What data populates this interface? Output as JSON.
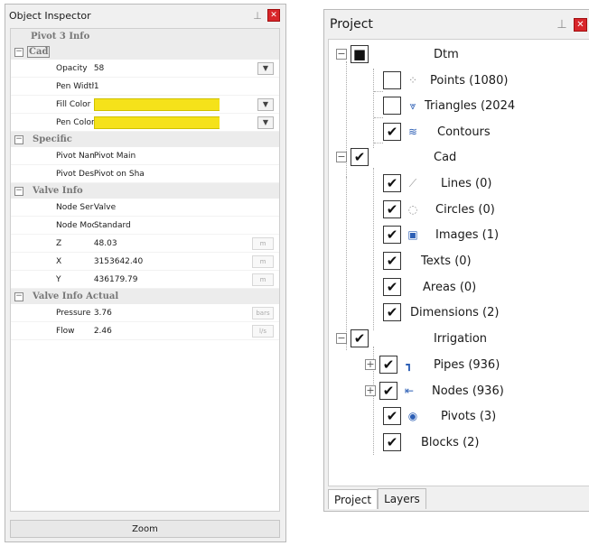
{
  "inspector": {
    "title": "Object Inspector",
    "header": "Pivot 3 Info",
    "categories": [
      {
        "name": "Cad",
        "rows": [
          {
            "key": "Opacity",
            "value": "58",
            "control": "dropdown"
          },
          {
            "key": "Pen Width",
            "value": "1"
          },
          {
            "key": "Fill Color",
            "value": "",
            "color": "#f5e21a",
            "control": "dropdown"
          },
          {
            "key": "Pen Color",
            "value": "",
            "color": "#f5e21a",
            "control": "dropdown"
          }
        ]
      },
      {
        "name": "Specific",
        "rows": [
          {
            "key": "Pivot Name",
            "value": "Pivot Main"
          },
          {
            "key": "Pivot Description",
            "value": "Pivot on Sha"
          }
        ]
      },
      {
        "name": "Valve Info",
        "rows": [
          {
            "key": "Node Series",
            "value": "Valve"
          },
          {
            "key": "Node Model",
            "value": "Standard"
          },
          {
            "key": "Z",
            "value": "48.03",
            "unit": "m"
          },
          {
            "key": "X",
            "value": "3153642.40",
            "unit": "m"
          },
          {
            "key": "Y",
            "value": "436179.79",
            "unit": "m"
          }
        ]
      },
      {
        "name": "Valve Info Actual",
        "rows": [
          {
            "key": "Pressure",
            "value": "3.76",
            "unit": "bars"
          },
          {
            "key": "Flow",
            "value": "2.46",
            "unit": "l/s"
          }
        ]
      }
    ],
    "zoom_label": "Zoom"
  },
  "project": {
    "title": "Project",
    "nodes": {
      "dtm": "Dtm",
      "points": "Points (1080)",
      "triangles": "Triangles (2024",
      "contours": "Contours",
      "cad": "Cad",
      "lines": "Lines (0)",
      "circles": "Circles (0)",
      "images": "Images (1)",
      "texts": "Texts (0)",
      "areas": "Areas (0)",
      "dimensions": "Dimensions (2)",
      "irrigation": "Irrigation",
      "pipes": "Pipes (936)",
      "nodes": "Nodes (936)",
      "pivots": "Pivots (3)",
      "blocks": "Blocks (2)"
    },
    "tabs": [
      "Project",
      "Layers"
    ]
  },
  "colors": {
    "fill_yellow": "#f5e21a",
    "close_red": "#d8252a",
    "icon_blue": "#2d5fb5"
  }
}
